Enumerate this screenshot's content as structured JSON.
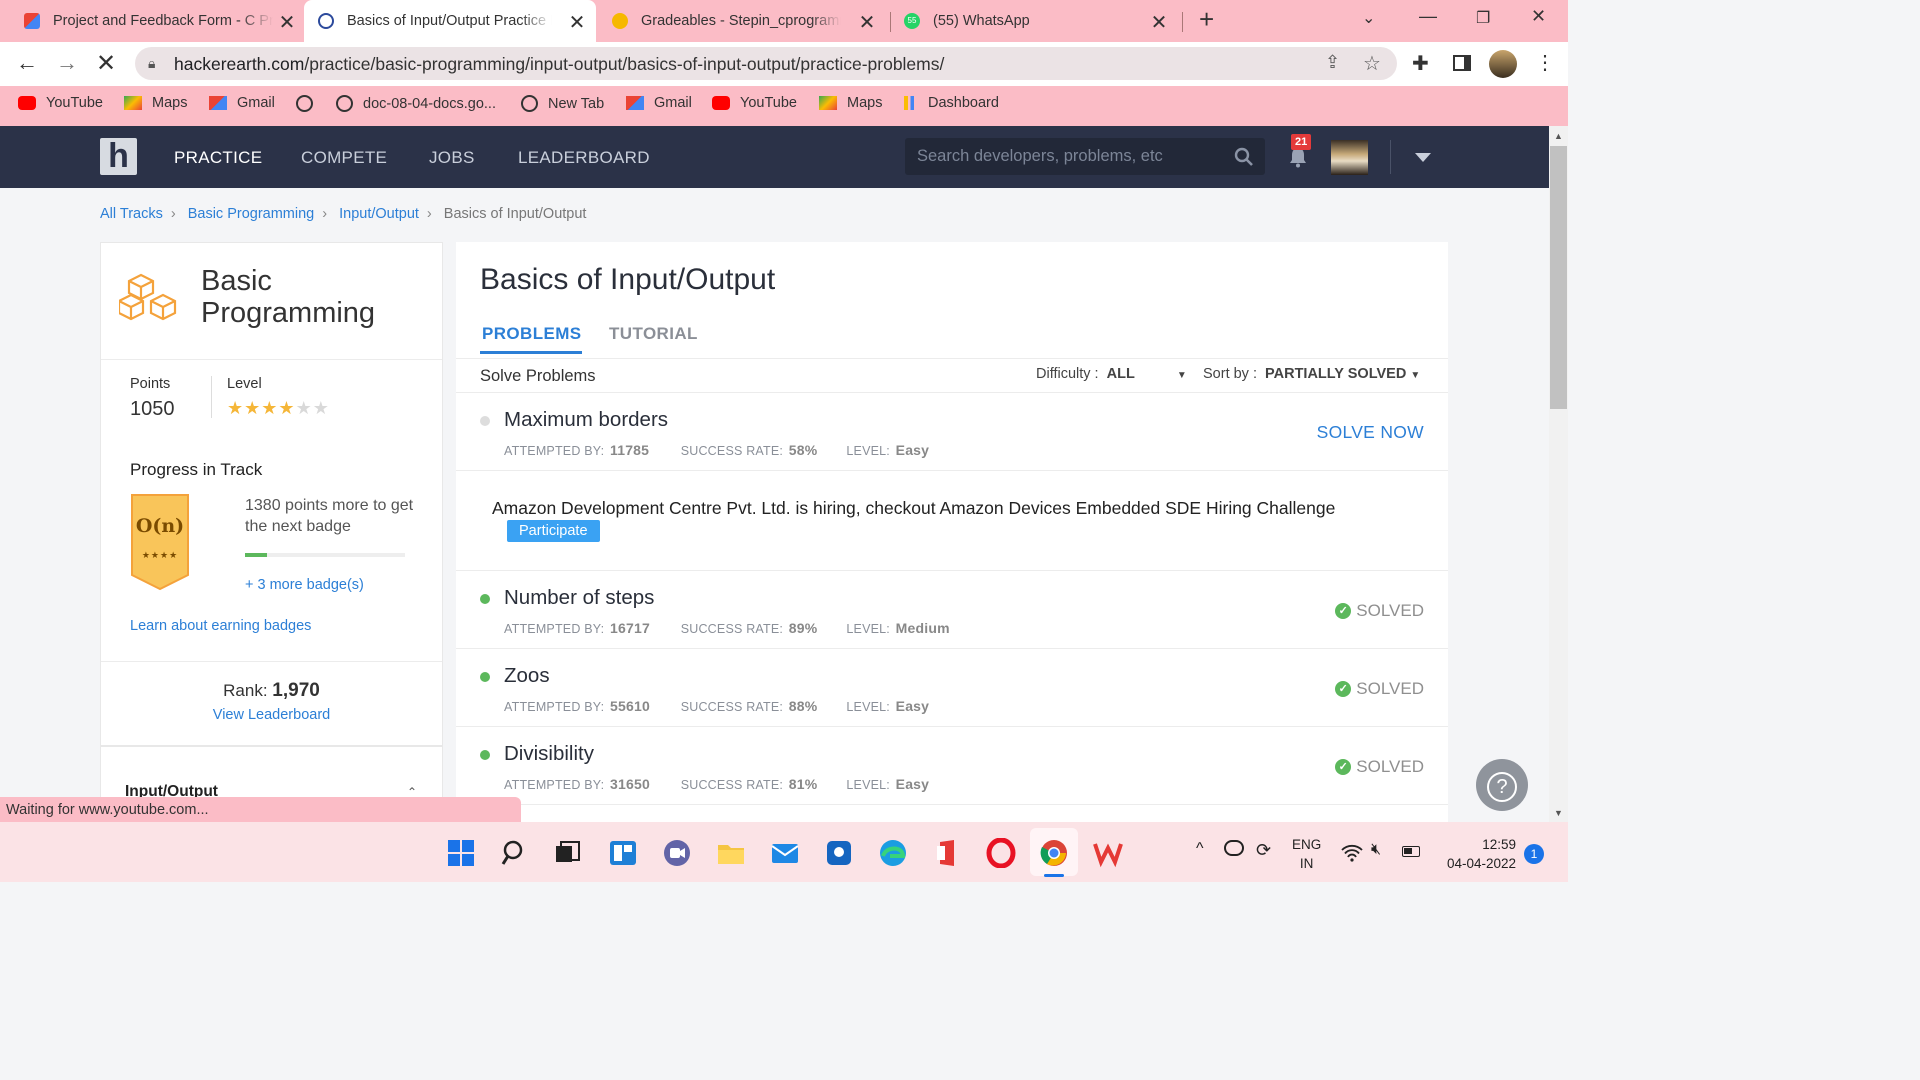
{
  "browser": {
    "tabs": [
      {
        "title": "Project and Feedback Form - C Programming"
      },
      {
        "title": "Basics of Input/Output Practice Problems"
      },
      {
        "title": "Gradeables - Stepin_cprogramming"
      },
      {
        "title": "(55) WhatsApp"
      }
    ],
    "whatsapp_badge": "55",
    "url_host": "hackerearth.com",
    "url_path": "/practice/basic-programming/input-output/basics-of-input-output/practice-problems/",
    "bookmarks": [
      "YouTube",
      "Maps",
      "Gmail",
      "",
      "doc-08-04-docs.go...",
      "New Tab",
      "Gmail",
      "YouTube",
      "Maps",
      "Dashboard"
    ]
  },
  "site": {
    "logo": "h",
    "nav": [
      "PRACTICE",
      "COMPETE",
      "JOBS",
      "LEADERBOARD"
    ],
    "search_placeholder": "Search developers, problems, etc",
    "notifications": "21"
  },
  "breadcrumb": [
    "All Tracks",
    "Basic Programming",
    "Input/Output",
    "Basics of Input/Output"
  ],
  "track": {
    "title_line1": "Basic",
    "title_line2": "Programming",
    "points_label": "Points",
    "points": "1050",
    "level_label": "Level",
    "stars": 4,
    "stars_total": 6,
    "progress_title": "Progress in Track",
    "badge_text": "O(n)",
    "badge_stars": "★★★★",
    "progress_text": "1380 points more to get the next badge",
    "progress_fraction": 0.14,
    "more_badges": "+ 3 more badge(s)",
    "learn_link": "Learn about earning badges",
    "rank_label": "Rank:",
    "rank": "1,970",
    "leaderboard_link": "View Leaderboard",
    "section_title": "Input/Output"
  },
  "main": {
    "title": "Basics of Input/Output",
    "tabs": [
      "PROBLEMS",
      "TUTORIAL"
    ],
    "solve_label": "Solve Problems",
    "difficulty_label": "Difficulty :",
    "difficulty_value": "ALL",
    "sort_label": "Sort by :",
    "sort_value": "PARTIALLY SOLVED",
    "attempted_label": "ATTEMPTED BY:",
    "rate_label": "SUCCESS RATE:",
    "level_label": "LEVEL:",
    "problems": [
      {
        "name": "Maximum borders",
        "attempted": "11785",
        "rate": "58%",
        "level": "Easy",
        "action": "SOLVE NOW"
      },
      {
        "name": "Number of steps",
        "attempted": "16717",
        "rate": "89%",
        "level": "Medium",
        "action": "SOLVED"
      },
      {
        "name": "Zoos",
        "attempted": "55610",
        "rate": "88%",
        "level": "Easy",
        "action": "SOLVED"
      },
      {
        "name": "Divisibility",
        "attempted": "31650",
        "rate": "81%",
        "level": "Easy",
        "action": "SOLVED"
      }
    ],
    "ad_text": "Amazon Development Centre Pvt. Ltd. is hiring, checkout Amazon Devices Embedded SDE Hiring Challenge",
    "ad_button": "Participate"
  },
  "status_bar": "Waiting for www.youtube.com...",
  "taskbar": {
    "lang_line1": "ENG",
    "lang_line2": "IN",
    "time": "12:59",
    "date": "04-04-2022",
    "notif": "1"
  },
  "colors": {
    "accent": "#2c7fd6",
    "nav": "#2b3248",
    "solved": "#5cb85c",
    "chrome": "#fbbcc6"
  }
}
